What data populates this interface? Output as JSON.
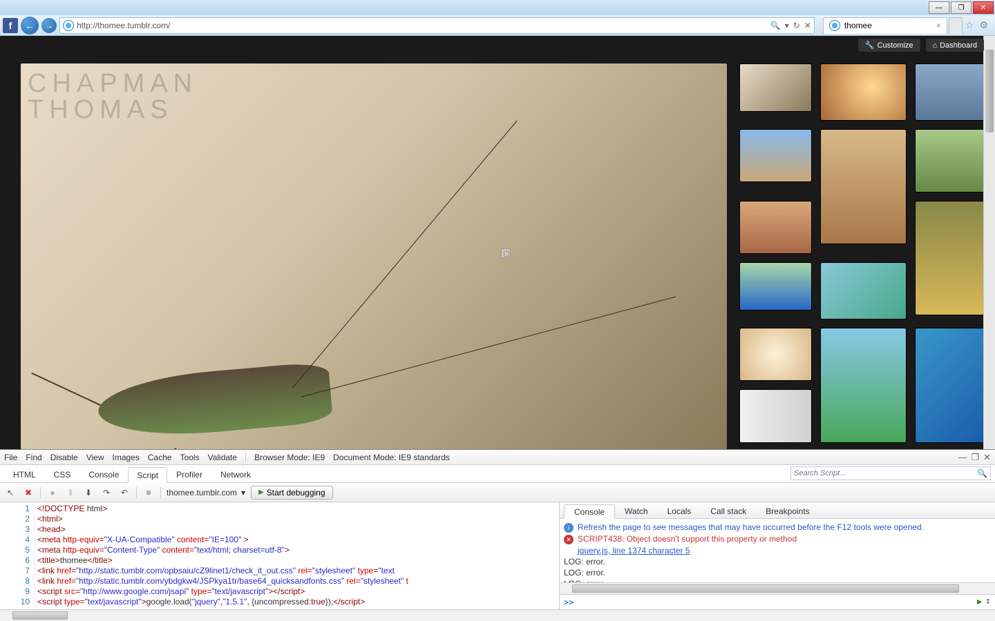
{
  "titlebar": {
    "minimize": "—",
    "maximize": "❐",
    "close": "✕"
  },
  "navbar": {
    "url": "http://thomee.tumblr.com/",
    "search_icon": "🔍",
    "refresh_icon": "↻",
    "stop_icon": "✕",
    "tab_title": "thomee",
    "tab_close": "×",
    "favorite_icon": "☆",
    "settings_icon": "⚙"
  },
  "page": {
    "hero_line1": "CHAPMAN",
    "hero_line2": "THOMAS",
    "customize": "Customize",
    "dashboard": "Dashboard"
  },
  "devtools": {
    "menu": [
      "File",
      "Find",
      "Disable",
      "View",
      "Images",
      "Cache",
      "Tools",
      "Validate"
    ],
    "browser_mode_label": "Browser Mode:",
    "browser_mode_value": "IE9",
    "document_mode_label": "Document Mode:",
    "document_mode_value": "IE9 standards",
    "tabs": [
      "HTML",
      "CSS",
      "Console",
      "Script",
      "Profiler",
      "Network"
    ],
    "active_tab": "Script",
    "search_placeholder": "Search Script...",
    "file_name": "thomee.tumblr.com",
    "start_debugging": "Start debugging",
    "right_tabs": [
      "Console",
      "Watch",
      "Locals",
      "Call stack",
      "Breakpoints"
    ],
    "active_right_tab": "Console",
    "console": {
      "info_msg": "Refresh the page to see messages that may have occurred before the F12 tools were opened.",
      "err_msg": "SCRIPT438: Object doesn't support this property or method",
      "err_link": "jquery.js, line 1374 character 5",
      "log1": "LOG: error.",
      "log2": "LOG: error.",
      "log3": "LOG: error.",
      "prompt": ">>"
    },
    "code_lines": {
      "l1": "1",
      "l2": "2",
      "l3": "3",
      "l4": "4",
      "l5": "5",
      "l6": "6",
      "l7": "7",
      "l8": "8",
      "l9": "9",
      "l10": "10"
    },
    "source": {
      "l1_a": "<!DOCTYPE",
      "l1_b": " html",
      "l1_c": ">",
      "l2_a": "<html>",
      "l3_a": "<head>",
      "l4_a": "<meta",
      "l4_b": " http-equiv=",
      "l4_c": "\"X-UA-Compatible\"",
      "l4_d": " content=",
      "l4_e": "\"IE=100\"",
      "l4_f": " >",
      "l5_a": "<meta",
      "l5_b": " http-equiv=",
      "l5_c": "\"Content-Type\"",
      "l5_d": " content=",
      "l5_e": "\"text/html; charset=utf-8\"",
      "l5_f": ">",
      "l6_a": "<title>",
      "l6_b": "thomee",
      "l6_c": "</title>",
      "l7_a": "<link",
      "l7_b": " href=",
      "l7_c": "\"http://static.tumblr.com/opbsaiu/cZ9linet1/check_it_out.css\"",
      "l7_d": " rel=",
      "l7_e": "\"stylesheet\"",
      "l7_f": " type=",
      "l7_g": "\"text",
      "l8_a": "<link",
      "l8_b": " href=",
      "l8_c": "\"http://static.tumblr.com/ybdgkw4/JSPkya1tr/base64_quicksandfonts.css\"",
      "l8_d": " rel=",
      "l8_e": "\"stylesheet\"",
      "l8_f": " t",
      "l9_a": "<script",
      "l9_b": " src=",
      "l9_c": "\"http://www.google.com/jsapi\"",
      "l9_d": " type=",
      "l9_e": "\"text/javascript\"",
      "l9_f": ">",
      "l9_g": "<",
      "l9_h": "/script>",
      "l10_a": "<script",
      "l10_b": " type=",
      "l10_c": "\"text/javascript\"",
      "l10_d": ">",
      "l10_e": "google.load(",
      "l10_f": "\"jquery\"",
      "l10_g": ",",
      "l10_h": "\"1.5.1\"",
      "l10_i": ", {uncompressed:",
      "l10_j": "true",
      "l10_k": "});",
      "l10_l": "<",
      "l10_m": "/script>"
    }
  }
}
